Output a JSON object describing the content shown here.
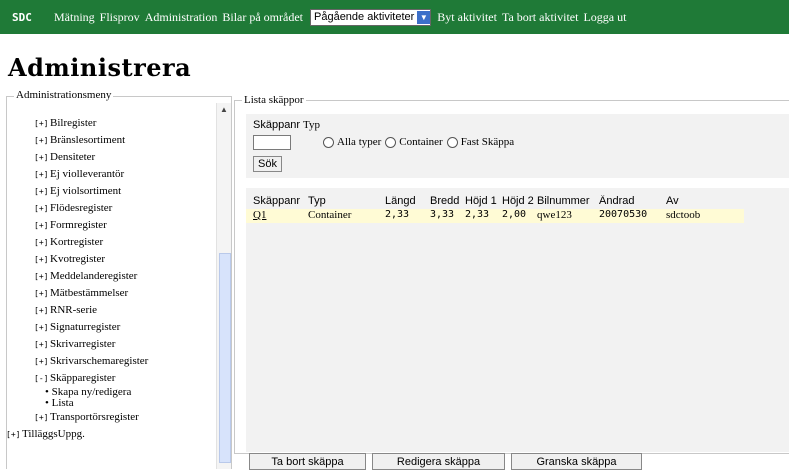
{
  "nav": {
    "logo": "SDC",
    "items": [
      "Mätning",
      "Flisprov",
      "Administration",
      "Bilar på området"
    ],
    "select_value": "Pågående aktiviteter",
    "items_after": [
      "Byt aktivitet",
      "Ta bort aktivitet",
      "Logga ut"
    ]
  },
  "page_title": "Administrera",
  "left_menu": {
    "legend": "Administrationsmeny",
    "items": [
      {
        "marker": "[+]",
        "label": "Bilregister"
      },
      {
        "marker": "[+]",
        "label": "Bränslesortiment"
      },
      {
        "marker": "[+]",
        "label": "Densiteter"
      },
      {
        "marker": "[+]",
        "label": "Ej violleverantör"
      },
      {
        "marker": "[+]",
        "label": "Ej violsortiment"
      },
      {
        "marker": "[+]",
        "label": "Flödesregister"
      },
      {
        "marker": "[+]",
        "label": "Formregister"
      },
      {
        "marker": "[+]",
        "label": "Kortregister"
      },
      {
        "marker": "[+]",
        "label": "Kvotregister"
      },
      {
        "marker": "[+]",
        "label": "Meddelanderegister"
      },
      {
        "marker": "[+]",
        "label": "Mätbestämmelser"
      },
      {
        "marker": "[+]",
        "label": "RNR-serie"
      },
      {
        "marker": "[+]",
        "label": "Signaturregister"
      },
      {
        "marker": "[+]",
        "label": "Skrivarregister"
      },
      {
        "marker": "[+]",
        "label": "Skrivarschemaregister"
      },
      {
        "marker": "[-]",
        "label": "Skäpparegister"
      }
    ],
    "subitems": [
      "Skapa ny/redigera",
      "Lista"
    ],
    "after": {
      "marker": "[+]",
      "label": "Transportörsregister"
    },
    "root": {
      "marker": "[+]",
      "label": "TilläggsUppg."
    }
  },
  "right": {
    "legend": "Lista skäppor",
    "search": {
      "label_nr": "Skäppanr",
      "label_typ": "Typ",
      "input_value": "",
      "radio_options": [
        "Alla typer",
        "Container",
        "Fast Skäppa"
      ],
      "search_button": "Sök"
    },
    "table": {
      "headers": [
        "Skäppanr",
        "Typ",
        "Längd",
        "Bredd",
        "Höjd 1",
        "Höjd 2",
        "Bilnummer",
        "Ändrad",
        "Av"
      ],
      "rows": [
        [
          "Q1",
          "Container",
          "2,33",
          "3,33",
          "2,33",
          "2,00",
          "qwe123",
          "20070530",
          "sdctoob"
        ]
      ]
    },
    "buttons": [
      "Ta bort skäppa",
      "Redigera skäppa",
      "Granska skäppa"
    ]
  },
  "colors": {
    "nav_bg": "#1f7a37",
    "row_highlight": "#fffbd5",
    "panel_bg": "#f2f2f2"
  }
}
